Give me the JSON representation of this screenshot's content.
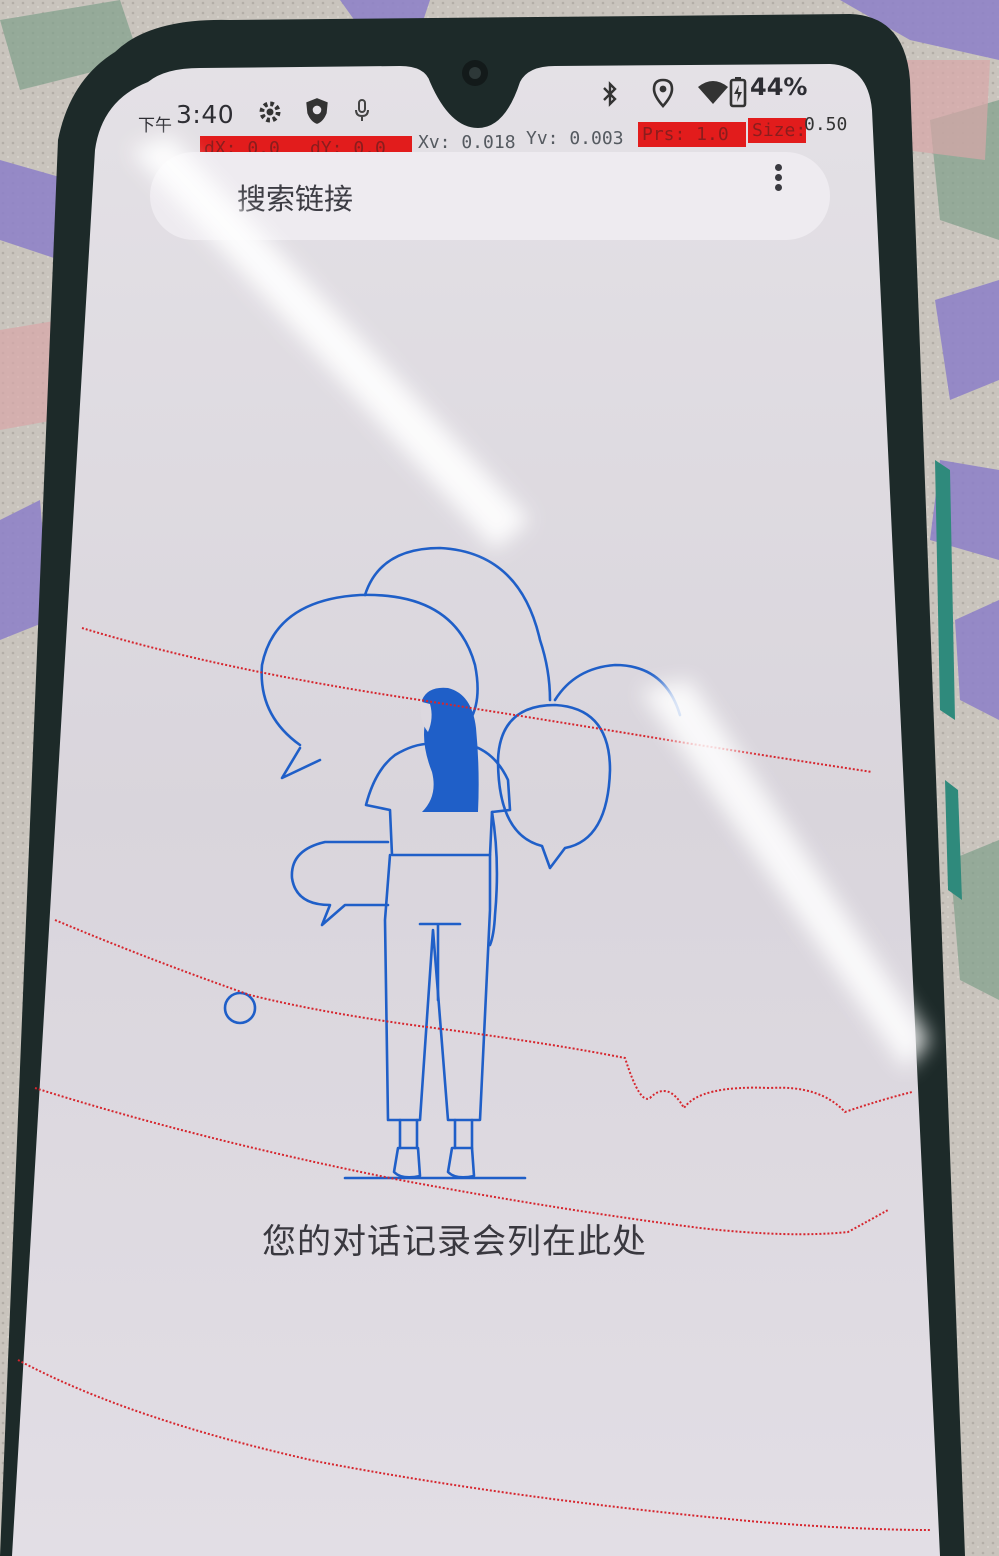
{
  "status_bar": {
    "ampm": "下午",
    "time": "3:40",
    "battery": "44%",
    "icons": [
      "gear-icon",
      "shield-icon",
      "mic-icon",
      "bluetooth-icon",
      "location-icon",
      "wifi-icon",
      "battery-icon"
    ]
  },
  "pointer_overlay": {
    "dx": "dX: 0.0",
    "dy": "dY: 0.0",
    "xv": "Xv: 0.018",
    "yv": "Yv: 0.003",
    "prs": "Prs: 1.0",
    "size_label": "Size:",
    "size_value": "0.50"
  },
  "search": {
    "title": "搜索链接",
    "menu_icon": "more-vert-icon"
  },
  "empty_state": {
    "illustration": "woman-with-speech-bubbles-illustration",
    "message": "您的对话记录会列在此处"
  },
  "colors": {
    "screen_bg": "#dcd8df",
    "illustration_blue": "#1f5fc8",
    "trace_red": "#d6262e"
  }
}
